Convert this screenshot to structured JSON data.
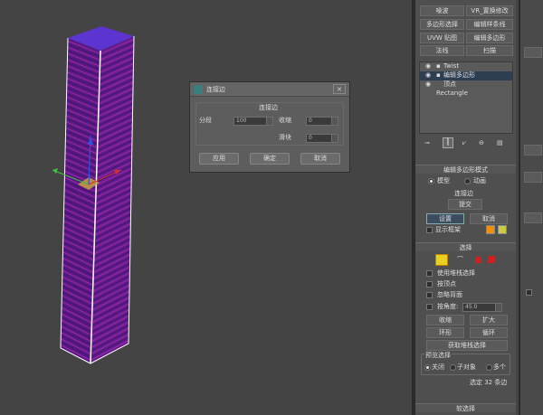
{
  "modifier_buttons": [
    {
      "label": "噪波"
    },
    {
      "label": "VR_置换修改"
    },
    {
      "label": "多边形选择"
    },
    {
      "label": "编辑样条线"
    },
    {
      "label": "UVW 贴图"
    },
    {
      "label": "编辑多边形"
    },
    {
      "label": "法线"
    },
    {
      "label": "扫描"
    }
  ],
  "stack": {
    "items": [
      "Twist",
      "编辑多边形",
      "顶点",
      "Rectangle"
    ]
  },
  "dialog": {
    "title": "连接边",
    "group_label": "连接边",
    "segments_label": "分段",
    "segments_value": "100",
    "pinch_label": "收缩",
    "pinch_value": "0",
    "slide_label": "滑块",
    "slide_value": "0",
    "apply": "应用",
    "ok": "确定",
    "cancel": "取消",
    "close": "×"
  },
  "edit_poly_mode": {
    "title": "编辑多边形模式",
    "model": "模型",
    "animate": "动画",
    "current_op": "连接边",
    "commit": "提交",
    "settings": "设置",
    "cancel": "取消",
    "show_cage": "显示框架"
  },
  "selection": {
    "title": "选择",
    "use_stack": "使用堆栈选择",
    "by_vertex": "按顶点",
    "ignore_backface": "忽略背面",
    "by_angle": "按角度:",
    "angle_value": "45.0",
    "shrink": "收缩",
    "grow": "扩大",
    "ring": "环形",
    "loop": "循环",
    "get_stack": "获取堆栈选择",
    "preview_title": "预览选择",
    "preview_off": "关闭",
    "preview_subobj": "子对象",
    "preview_multi": "多个",
    "status": "选定 32 条边"
  },
  "soft_selection": {
    "title": "软选择"
  },
  "colors": {
    "column_top": "#6a35cc",
    "column_side": "#5e1a88",
    "edge_highlight": "#ffffff"
  }
}
